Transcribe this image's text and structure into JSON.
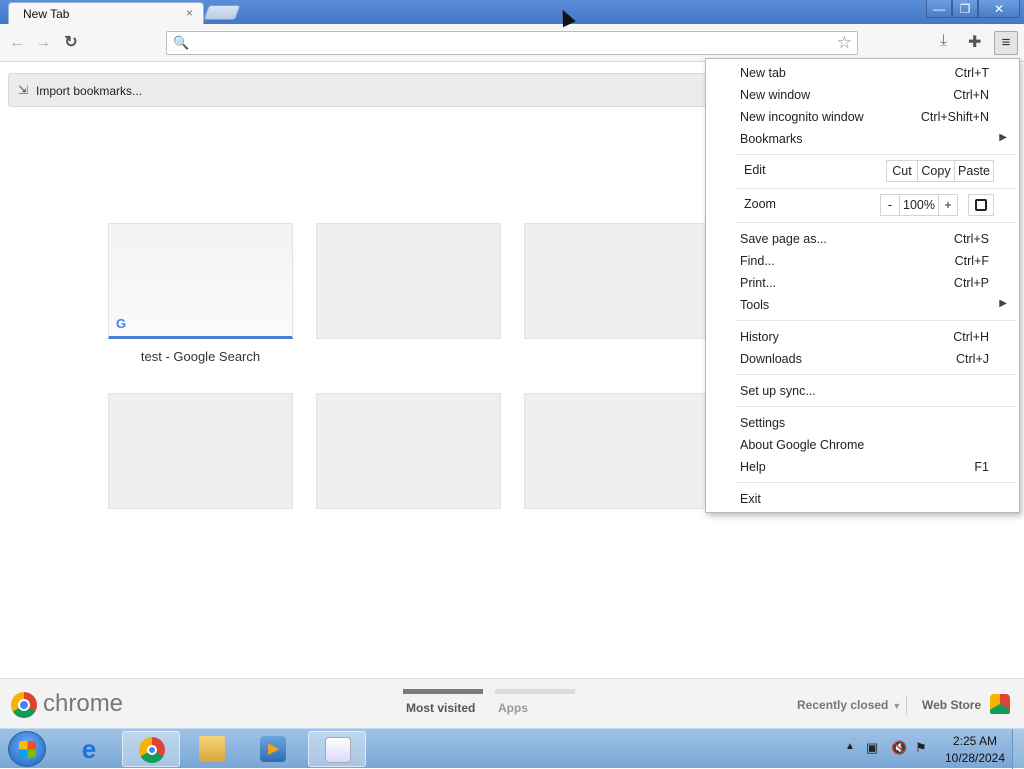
{
  "tab": {
    "title": "New Tab",
    "close": "×"
  },
  "window_controls": {
    "minimize": "—",
    "maximize": "❐",
    "close": "✕"
  },
  "toolbar": {
    "back": "←",
    "forward": "→",
    "reload": "↻",
    "search_icon": "🔍",
    "omnibox_value": "",
    "star": "☆",
    "download_icon": "⤓",
    "extension_icon": "✚",
    "menu_icon": "≡"
  },
  "bookmarks": {
    "import_icon": "⇲",
    "import_label": "Import bookmarks..."
  },
  "thumbnails": {
    "first_label": "test - Google Search",
    "g_icon": "G"
  },
  "footer": {
    "brand": "chrome",
    "most_visited": "Most visited",
    "apps": "Apps",
    "recently_closed": "Recently closed",
    "caret": "▼",
    "web_store": "Web Store"
  },
  "menu": {
    "items": [
      {
        "label": "New tab",
        "shortcut": "Ctrl+T"
      },
      {
        "label": "New window",
        "shortcut": "Ctrl+N"
      },
      {
        "label": "New incognito window",
        "shortcut": "Ctrl+Shift+N"
      },
      {
        "label": "Bookmarks",
        "arrow": "▶"
      }
    ],
    "edit": {
      "label": "Edit",
      "cut": "Cut",
      "copy": "Copy",
      "paste": "Paste"
    },
    "zoom": {
      "label": "Zoom",
      "minus": "-",
      "value": "100%",
      "plus": "+"
    },
    "items2": [
      {
        "label": "Save page as...",
        "shortcut": "Ctrl+S"
      },
      {
        "label": "Find...",
        "shortcut": "Ctrl+F"
      },
      {
        "label": "Print...",
        "shortcut": "Ctrl+P"
      },
      {
        "label": "Tools",
        "arrow": "▶"
      }
    ],
    "items3": [
      {
        "label": "History",
        "shortcut": "Ctrl+H"
      },
      {
        "label": "Downloads",
        "shortcut": "Ctrl+J"
      }
    ],
    "sync": "Set up sync...",
    "items4": [
      {
        "label": "Settings",
        "shortcut": ""
      },
      {
        "label": "About Google Chrome",
        "shortcut": ""
      },
      {
        "label": "Help",
        "shortcut": "F1"
      }
    ],
    "exit": "Exit"
  },
  "taskbar": {
    "ie_glyph": "e",
    "tray_arrow": "▲",
    "network_icon": "▣",
    "volume_icon": "🔇",
    "flag_icon": "⚑",
    "time": "2:25 AM",
    "date": "10/28/2024"
  }
}
